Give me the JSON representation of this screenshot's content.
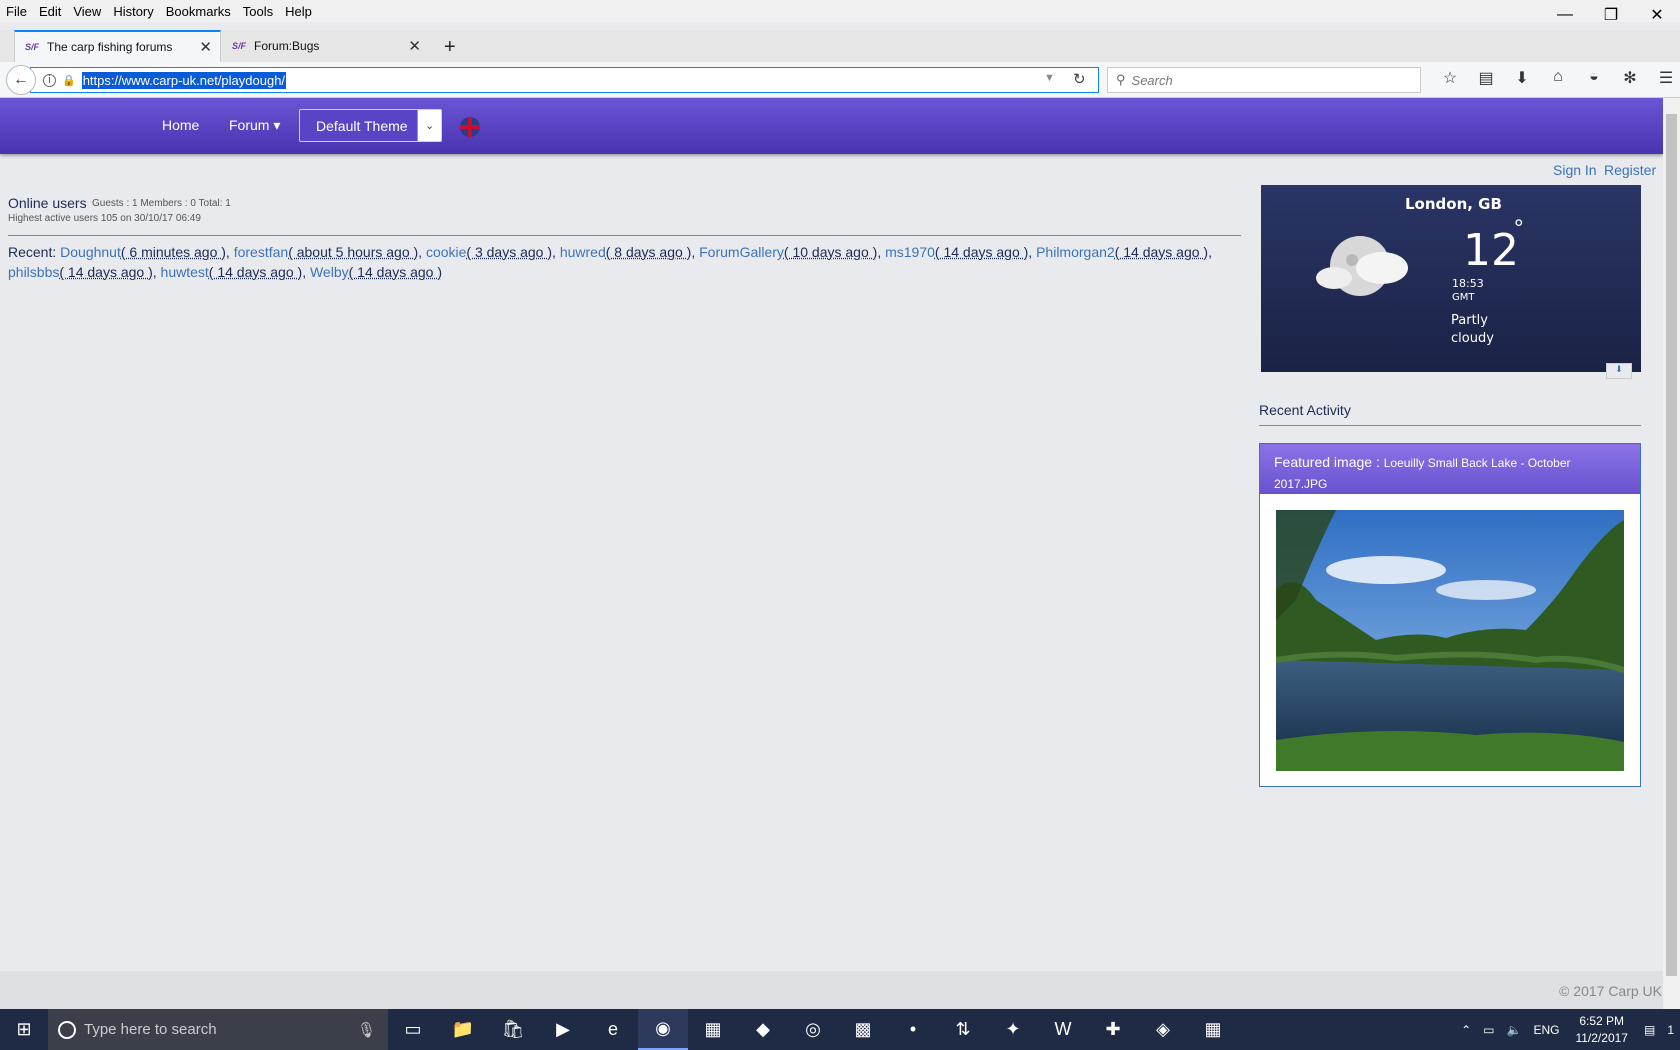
{
  "menubar": {
    "items": [
      "File",
      "Edit",
      "View",
      "History",
      "Bookmarks",
      "Tools",
      "Help"
    ]
  },
  "window_controls": {
    "minimize": "—",
    "restore": "❐",
    "close": "✕"
  },
  "tabs": [
    {
      "label": "The carp fishing forums",
      "favicon": "S/F"
    },
    {
      "label": "Forum:Bugs",
      "favicon": "S/F"
    }
  ],
  "navbar": {
    "url": "https://www.carp-uk.net/playdough/",
    "search_placeholder": "Search"
  },
  "site_nav": {
    "home": "Home",
    "forum": "Forum ▾",
    "theme": "Default Theme"
  },
  "auth": {
    "signin": "Sign In",
    "register": "Register"
  },
  "online": {
    "title": "Online users",
    "counts": "Guests : 1 Members : 0 Total: 1",
    "highest": "Highest active users 105 on 30/10/17 06:49"
  },
  "recent": {
    "label": "Recent:",
    "users": [
      {
        "name": "Doughnut",
        "time": "( 6 minutes ago )"
      },
      {
        "name": "forestfan",
        "time": "( about 5 hours ago )"
      },
      {
        "name": "cookie",
        "time": "( 3 days ago )"
      },
      {
        "name": "huwred",
        "time": "( 8 days ago )"
      },
      {
        "name": "ForumGallery",
        "time": "( 10 days ago )"
      },
      {
        "name": "ms1970",
        "time": "( 14 days ago )"
      },
      {
        "name": "Philmorgan2",
        "time": "( 14 days ago )"
      },
      {
        "name": "philsbbs",
        "time": "( 14 days ago )"
      },
      {
        "name": "huwtest",
        "time": "( 14 days ago )"
      },
      {
        "name": "Welby",
        "time": "( 14 days ago )"
      }
    ]
  },
  "weather": {
    "city": "London, GB",
    "temp": "12",
    "deg": "°",
    "time": "18:53",
    "tz": "GMT",
    "condition": "Partly cloudy"
  },
  "sidebar": {
    "recent_activity": "Recent Activity"
  },
  "featured": {
    "prefix": "Featured image :",
    "filename": "Loeuilly Small Back Lake - October 2017.JPG"
  },
  "footer": {
    "copyright": "© 2017 Carp UK"
  },
  "taskbar": {
    "search_placeholder": "Type here to search",
    "lang": "ENG",
    "time": "6:52 PM",
    "date": "11/2/2017",
    "notifications": "1"
  },
  "colors": {
    "header": "#5a44c8",
    "link": "#3b73b9",
    "accent": "#0a84ff"
  }
}
